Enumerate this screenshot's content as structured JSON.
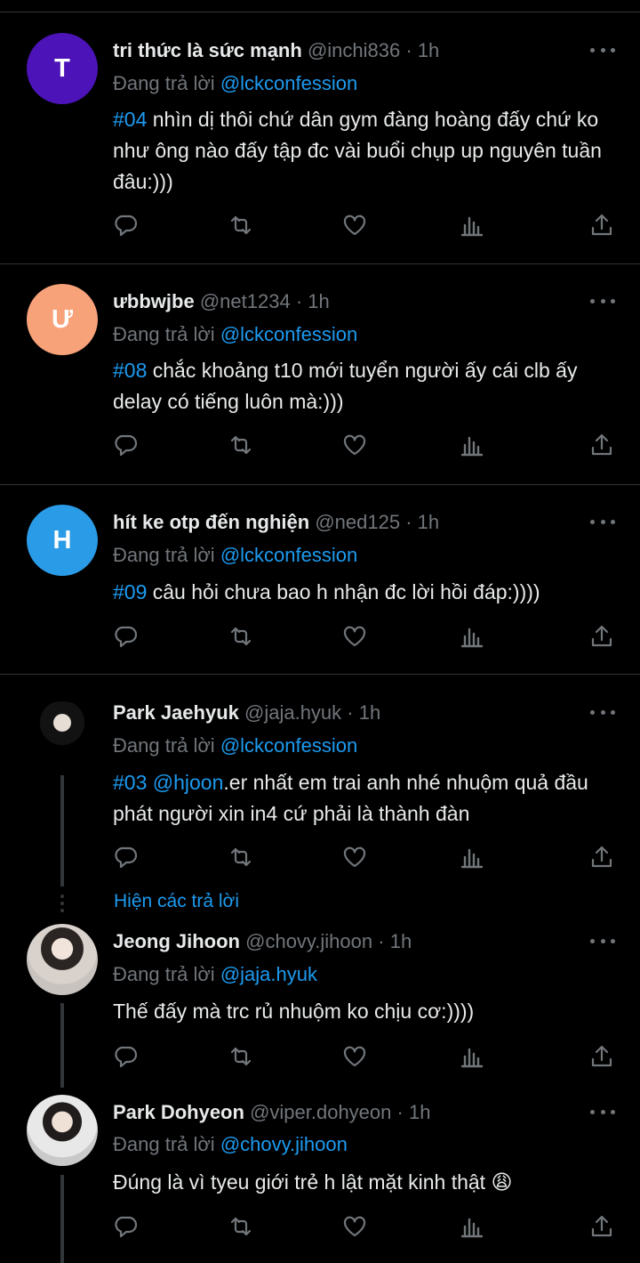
{
  "reply_prefix": "Đang trả lời",
  "show_replies_label": "Hiện các trả lời",
  "tweets": [
    {
      "avatar_letter": "T",
      "avatar_color": "#4c14b8",
      "name": "tri thức là sức mạnh",
      "handle": "@inchi836",
      "time": "1h",
      "reply_to": "@lckconfession",
      "hashtag": "#04",
      "text": " nhìn dị thôi chứ dân gym đàng hoàng đấy chứ ko như ông nào đấy tập đc vài buổi chụp up nguyên tuần đâu:)))"
    },
    {
      "avatar_letter": "Ư",
      "avatar_color": "#f8a27a",
      "name": "ưbbwjbe",
      "handle": "@net1234",
      "time": "1h",
      "reply_to": "@lckconfession",
      "hashtag": "#08",
      "text": " chắc khoảng t10 mới tuyển người ấy cái clb ấy delay có tiếng luôn mà:)))"
    },
    {
      "avatar_letter": "H",
      "avatar_color": "#2a9be6",
      "name": "hít ke otp đến nghiện",
      "handle": "@ned125",
      "time": "1h",
      "reply_to": "@lckconfession",
      "hashtag": "#09",
      "text": " câu hỏi chưa bao h nhận đc lời hồi đáp:))))"
    },
    {
      "name": "Park Jaehyuk",
      "handle": "@jaja.hyuk",
      "time": "1h",
      "reply_to": "@lckconfession",
      "hashtag": "#03",
      "mention": "@hjoon",
      "text": ".er nhất em trai anh nhé nhuộm quả đầu phát người xin in4 cứ phải là thành đàn"
    },
    {
      "name": "Jeong Jihoon",
      "handle": "@chovy.jihoon",
      "time": "1h",
      "reply_to": "@jaja.hyuk",
      "text": "Thế đấy mà trc rủ nhuộm ko chịu cơ:))))"
    },
    {
      "name": "Park Dohyeon",
      "handle": "@viper.dohyeon",
      "time": "1h",
      "reply_to": "@chovy.jihoon",
      "text": "Đúng là vì tyeu giới trẻ h lật mặt kinh thật 😩"
    }
  ]
}
